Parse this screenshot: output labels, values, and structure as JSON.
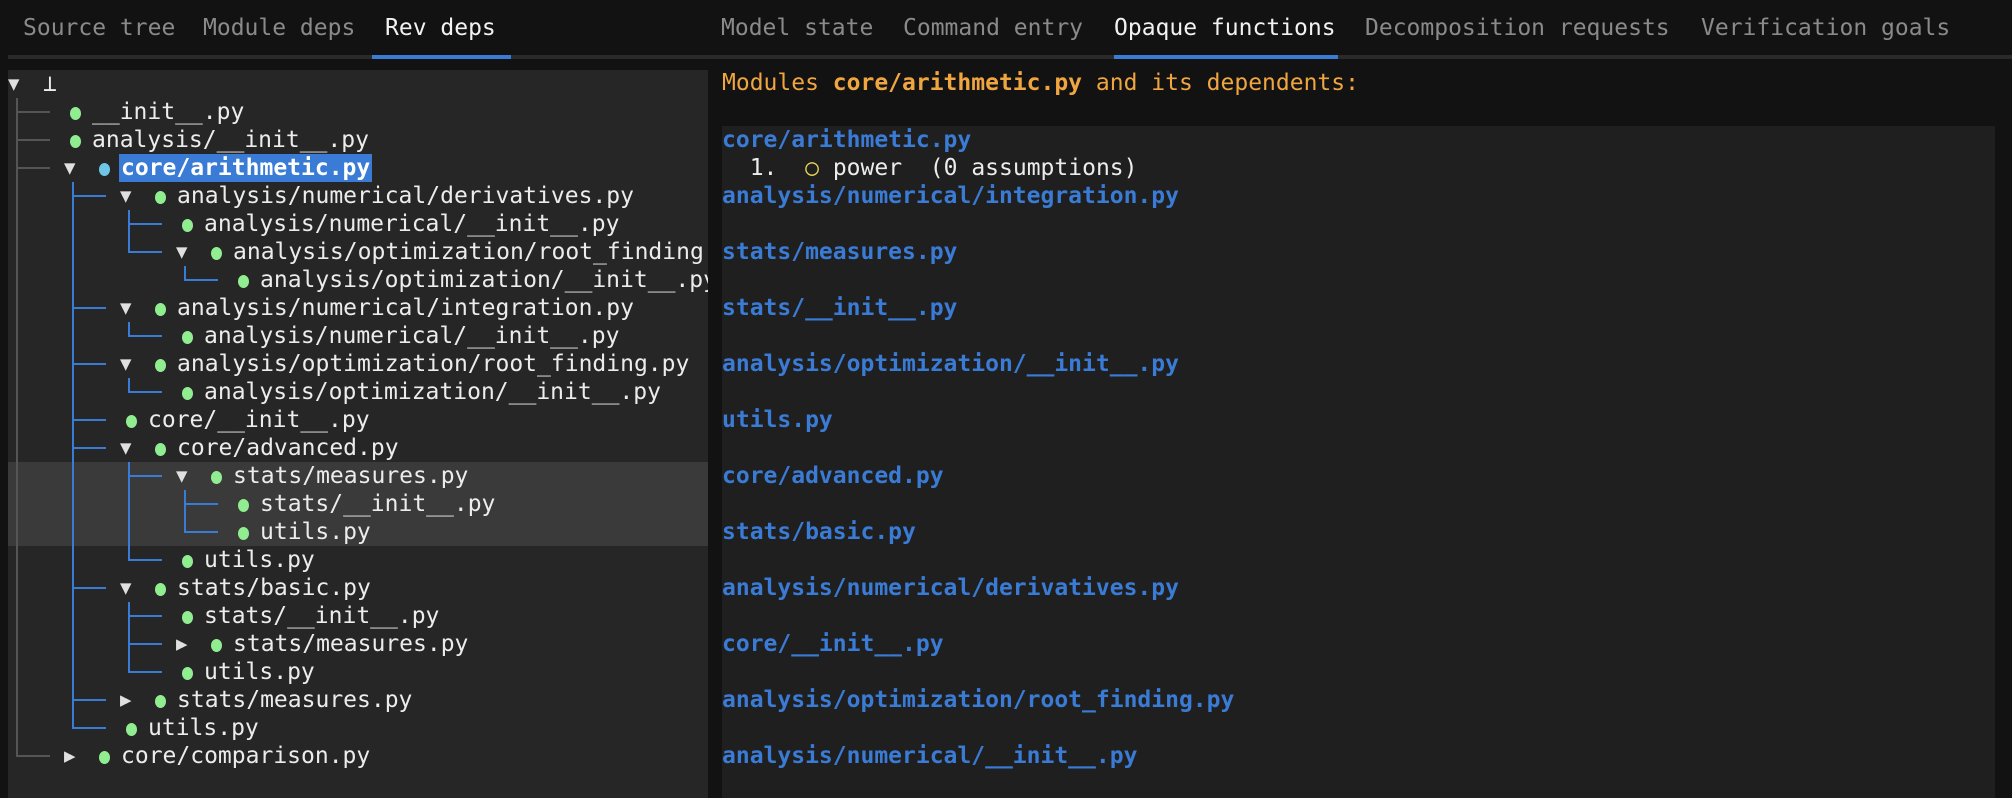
{
  "left_tabs": [
    {
      "label": "Source tree",
      "active": false
    },
    {
      "label": "Module deps",
      "active": false
    },
    {
      "label": "Rev deps",
      "active": true
    }
  ],
  "right_tabs": [
    {
      "label": "Model state",
      "active": false
    },
    {
      "label": "Command entry",
      "active": false
    },
    {
      "label": "Opaque functions",
      "active": true
    },
    {
      "label": "Decomposition requests",
      "active": false
    },
    {
      "label": "Verification goals",
      "active": false
    }
  ],
  "colors": {
    "accent": "#3a7bd5",
    "heading": "#f0a640",
    "dot": "#90ee90",
    "selected_dot": "#6ec6e6",
    "guide": "#555555"
  },
  "tree": {
    "label": "⊥",
    "open": true,
    "children": [
      {
        "label": "__init__.py"
      },
      {
        "label": "analysis/__init__.py"
      },
      {
        "label": "core/arithmetic.py",
        "open": true,
        "selected": true,
        "children": [
          {
            "label": "analysis/numerical/derivatives.py",
            "open": true,
            "children": [
              {
                "label": "analysis/numerical/__init__.py"
              },
              {
                "label": "analysis/optimization/root_finding.py",
                "open": true,
                "children": [
                  {
                    "label": "analysis/optimization/__init__.py"
                  }
                ]
              }
            ]
          },
          {
            "label": "analysis/numerical/integration.py",
            "open": true,
            "children": [
              {
                "label": "analysis/numerical/__init__.py"
              }
            ]
          },
          {
            "label": "analysis/optimization/root_finding.py",
            "open": true,
            "children": [
              {
                "label": "analysis/optimization/__init__.py"
              }
            ]
          },
          {
            "label": "core/__init__.py"
          },
          {
            "label": "core/advanced.py",
            "open": true,
            "children": [
              {
                "label": "stats/measures.py",
                "open": true,
                "hover": true,
                "children": [
                  {
                    "label": "stats/__init__.py",
                    "hover": true
                  },
                  {
                    "label": "utils.py",
                    "hover": true
                  }
                ]
              },
              {
                "label": "utils.py"
              }
            ]
          },
          {
            "label": "stats/basic.py",
            "open": true,
            "children": [
              {
                "label": "stats/__init__.py"
              },
              {
                "label": "stats/measures.py",
                "open": false,
                "collapsed": true
              },
              {
                "label": "utils.py"
              }
            ]
          },
          {
            "label": "stats/measures.py",
            "open": false,
            "collapsed": true
          },
          {
            "label": "utils.py"
          }
        ]
      },
      {
        "label": "core/comparison.py",
        "open": false,
        "collapsed": true
      }
    ]
  },
  "opaque": {
    "heading_prefix": "Modules ",
    "heading_module": "core/arithmetic.py",
    "heading_suffix": " and its dependents:",
    "modules": [
      {
        "name": "core/arithmetic.py",
        "functions": [
          {
            "index": "1.",
            "name": "power",
            "assumptions": "(0 assumptions)"
          }
        ]
      },
      {
        "name": "analysis/numerical/integration.py",
        "functions": []
      },
      {
        "name": "stats/measures.py",
        "functions": []
      },
      {
        "name": "stats/__init__.py",
        "functions": []
      },
      {
        "name": "analysis/optimization/__init__.py",
        "functions": []
      },
      {
        "name": "utils.py",
        "functions": []
      },
      {
        "name": "core/advanced.py",
        "functions": []
      },
      {
        "name": "stats/basic.py",
        "functions": []
      },
      {
        "name": "analysis/numerical/derivatives.py",
        "functions": []
      },
      {
        "name": "core/__init__.py",
        "functions": []
      },
      {
        "name": "analysis/optimization/root_finding.py",
        "functions": []
      },
      {
        "name": "analysis/numerical/__init__.py",
        "functions": []
      }
    ]
  }
}
